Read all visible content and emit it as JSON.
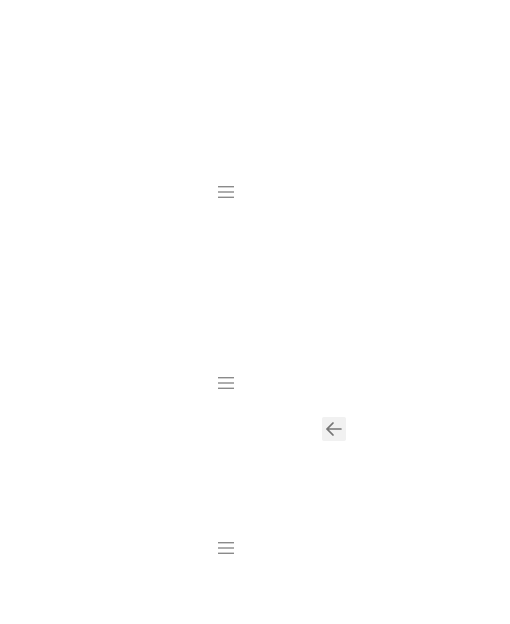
{
  "icons": {
    "menu": "hamburger-menu-icon",
    "back": "arrow-left-icon"
  },
  "colors": {
    "background": "#ffffff",
    "icon": "#757575",
    "back_button_bg": "#f1f1f1"
  }
}
